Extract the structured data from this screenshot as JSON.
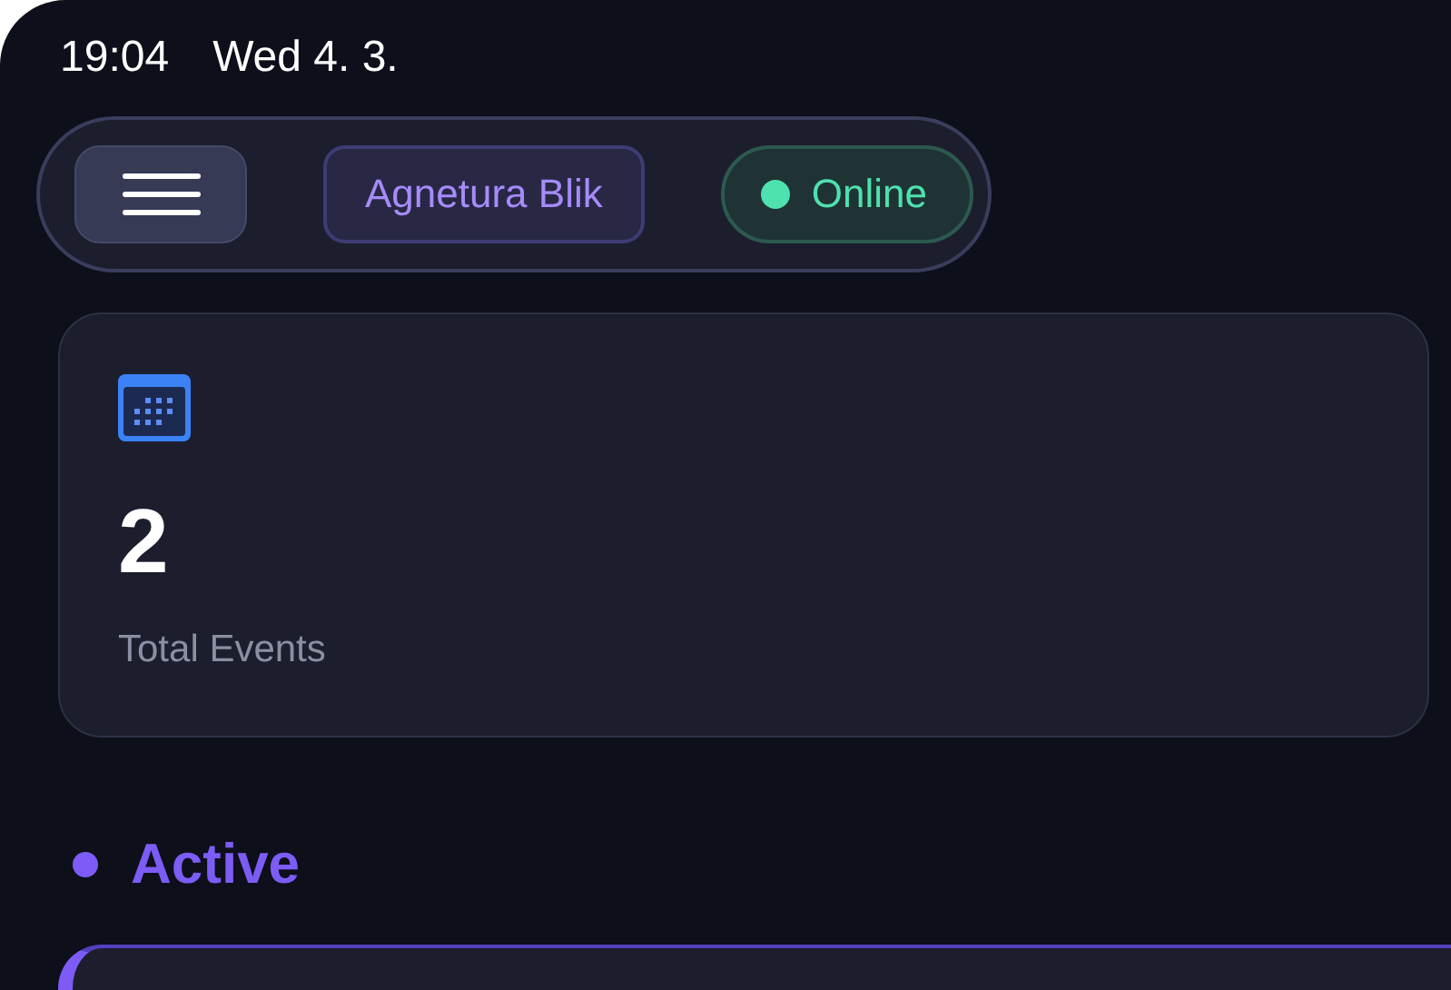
{
  "status_bar": {
    "time": "19:04",
    "date": "Wed 4. 3."
  },
  "toolbar": {
    "user": "Agnetura Blik",
    "status": "Online"
  },
  "stats": [
    {
      "value": "2",
      "label": "Total Events"
    }
  ],
  "section": {
    "title": "Active"
  }
}
